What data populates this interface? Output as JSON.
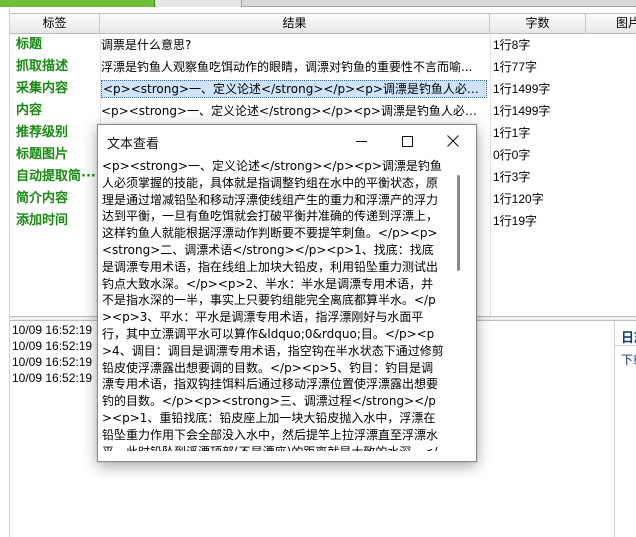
{
  "grid": {
    "columns": [
      "标签",
      "结果",
      "字数",
      "图片"
    ],
    "rows": [
      {
        "tag": "标题",
        "result": "调票是什么意思?",
        "count": "1行8字"
      },
      {
        "tag": "抓取描述",
        "result": "浮漂是钓鱼人观察鱼吃饵动作的眼睛，调漂对钓鱼的重要性不言而喻...",
        "count": "1行77字"
      },
      {
        "tag": "采集内容",
        "result": "<p><strong>一、定义论述</strong></p><p>调漂是钓鱼人必须掌握的技能，具体就是...",
        "count": "1行1499字"
      },
      {
        "tag": "内容",
        "result": "<p><strong>一、定义论述</strong></p><p>调漂是钓鱼人必须掌握的技能...",
        "count": "1行1499字"
      },
      {
        "tag": "推荐级别",
        "result": "",
        "count": "1行1字"
      },
      {
        "tag": "标题图片",
        "result": "",
        "count": "0行0字"
      },
      {
        "tag": "自动提取简···",
        "result": "",
        "count": "1行3字"
      },
      {
        "tag": "简介内容",
        "result": "",
        "count": "1行120字"
      },
      {
        "tag": "添加时间",
        "result": "",
        "count": "1行19字"
      }
    ]
  },
  "log": {
    "lines": [
      "10/09 16:52:19",
      "10/09 16:52:19",
      "10/09 16:52:19",
      "10/09 16:52:19"
    ]
  },
  "right_panel": {
    "title": "日志",
    "text": "下载"
  },
  "dialog": {
    "title": "文本查看",
    "content": "<p><strong>一、定义论述</strong></p><p>调漂是钓鱼人必须掌握的技能，具体就是指调整钓组在水中的平衡状态，原理是通过增减铅坠和移动浮漂使线组产生的重力和浮漂产的浮力达到平衡，一旦有鱼吃饵就会打破平衡并准确的传递到浮漂上，这样钓鱼人就能根据浮漂动作判断要不要提竿刺鱼。</p><p><strong>二、调漂术语</strong></p><p>1、找底：找底是调漂专用术语，指在线组上加块大铅皮，利用铅坠重力测试出钓点大致水深。</p><p>2、半水：半水是调漂专用术语，并不是指水深的一半，事实上只要钓组能完全离底都算半水。</p><p>3、平水：平水是调漂专用术语，指浮漂刚好与水面平行，其中立漂调平水可以算作&ldquo;0&rdquo;目。</p><p>4、调目：调目是调漂专用术语，指空钩在半水状态下通过修剪铅皮使浮漂露出想要调的目数。</p><p>5、钓目：钓目是调漂专用术语，指双钩挂饵料后通过移动浮漂位置使浮漂露出想要钓的目数。</p><p><strong>三、调漂过程</strong></p><p>1、重铅找底：铅皮座上加一块大铅皮抛入水中，浮漂在铅坠重力作用下会全部没入水中，然后提竿上拉浮漂直至浮漂水平，此时铅坠到浮漂顶部(不是漂座)的距离就是大致的水深。</p><p>2、半水调目：浮漂下拉大于钓点子线长度的距离，然后将鱼钩中夹上浮漂漂出想要调的目数，例如调目线..."
  },
  "colors": {
    "tag_green": "#1a8a14",
    "selection": "#cfe3fb",
    "tab_green": "#6fbe3a"
  }
}
